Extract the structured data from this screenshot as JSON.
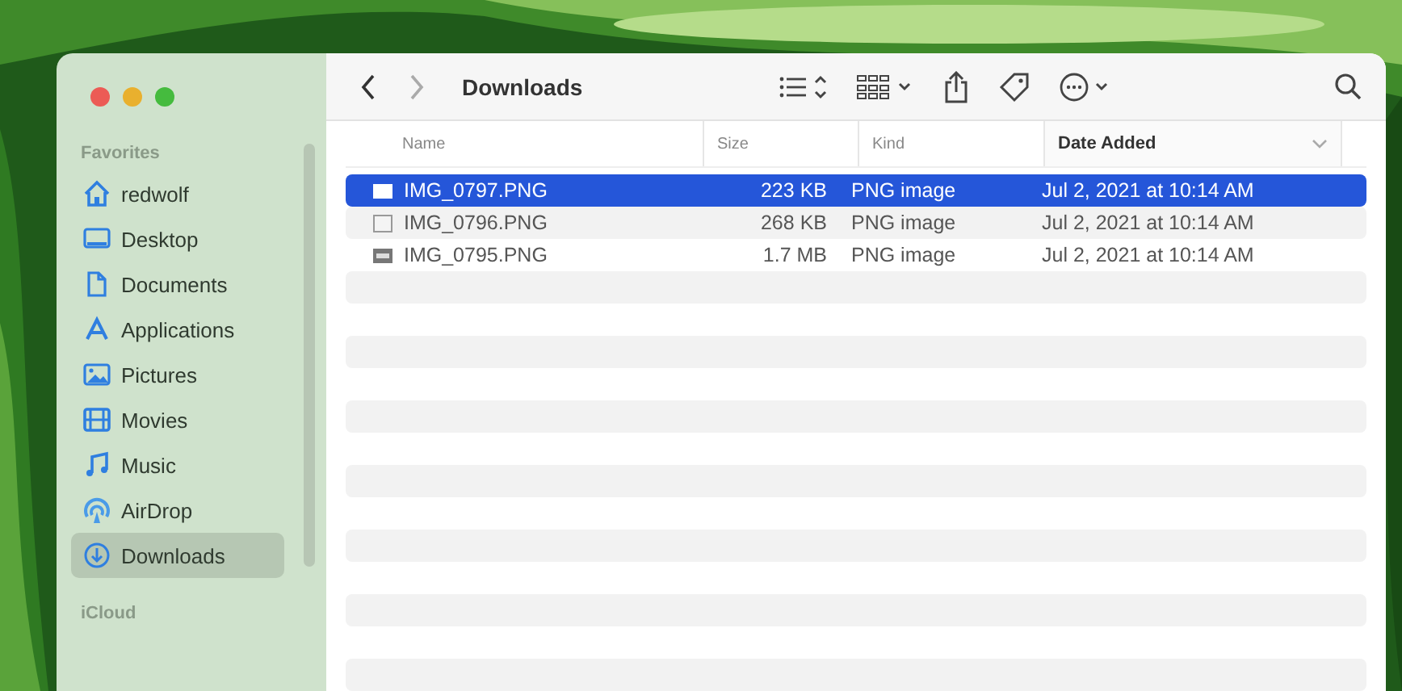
{
  "window": {
    "title": "Downloads"
  },
  "sidebar": {
    "sections": [
      {
        "heading": "Favorites",
        "items": [
          {
            "label": "redwolf",
            "selected": false
          },
          {
            "label": "Desktop",
            "selected": false
          },
          {
            "label": "Documents",
            "selected": false
          },
          {
            "label": "Applications",
            "selected": false
          },
          {
            "label": "Pictures",
            "selected": false
          },
          {
            "label": "Movies",
            "selected": false
          },
          {
            "label": "Music",
            "selected": false
          },
          {
            "label": "AirDrop",
            "selected": false
          },
          {
            "label": "Downloads",
            "selected": true
          }
        ]
      },
      {
        "heading": "iCloud"
      }
    ]
  },
  "table": {
    "columns": [
      {
        "label": "Name",
        "sorted": false
      },
      {
        "label": "Size",
        "sorted": false
      },
      {
        "label": "Kind",
        "sorted": false
      },
      {
        "label": "Date Added",
        "sorted": true
      }
    ],
    "rows": [
      {
        "name": "IMG_0797.PNG",
        "size": "223 KB",
        "kind": "PNG image",
        "date": "Jul 2, 2021 at 10:14 AM",
        "selected": true
      },
      {
        "name": "IMG_0796.PNG",
        "size": "268 KB",
        "kind": "PNG image",
        "date": "Jul 2, 2021 at 10:14 AM",
        "selected": false
      },
      {
        "name": "IMG_0795.PNG",
        "size": "1.7 MB",
        "kind": "PNG image",
        "date": "Jul 2, 2021 at 10:14 AM",
        "selected": false
      }
    ]
  }
}
